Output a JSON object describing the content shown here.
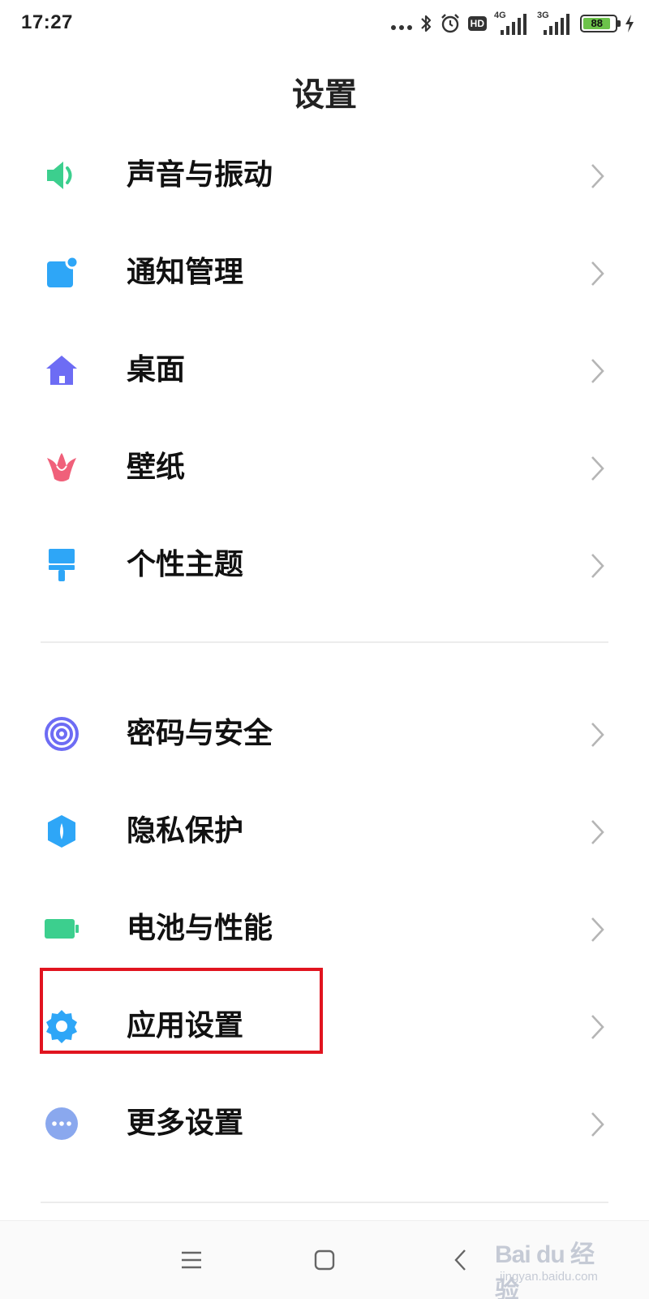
{
  "status": {
    "time": "17:27",
    "signal1_label": "4G",
    "signal2_label": "3G",
    "hd_label": "HD",
    "battery_level": "88"
  },
  "title": "设置",
  "items": [
    {
      "label": "声音与振动",
      "icon": "speaker-icon",
      "color": "#3ccf8e"
    },
    {
      "label": "通知管理",
      "icon": "notification-icon",
      "color": "#2ea6f7"
    },
    {
      "label": "桌面",
      "icon": "home-icon",
      "color": "#6d6cf4"
    },
    {
      "label": "壁纸",
      "icon": "tulip-icon",
      "color": "#f0607a"
    },
    {
      "label": "个性主题",
      "icon": "paintbrush-icon",
      "color": "#2ea6f7"
    },
    {
      "label": "密码与安全",
      "icon": "fingerprint-icon",
      "color": "#6d6cf4"
    },
    {
      "label": "隐私保护",
      "icon": "privacy-shield-icon",
      "color": "#2ea6f7"
    },
    {
      "label": "电池与性能",
      "icon": "battery-icon",
      "color": "#3ccf8e"
    },
    {
      "label": "应用设置",
      "icon": "gear-icon",
      "color": "#2ea6f7"
    },
    {
      "label": "更多设置",
      "icon": "more-dots-icon",
      "color": "#8aa8ee"
    }
  ],
  "watermark": {
    "text": "Bai du 经验",
    "sub": "jingyan.baidu.com"
  }
}
